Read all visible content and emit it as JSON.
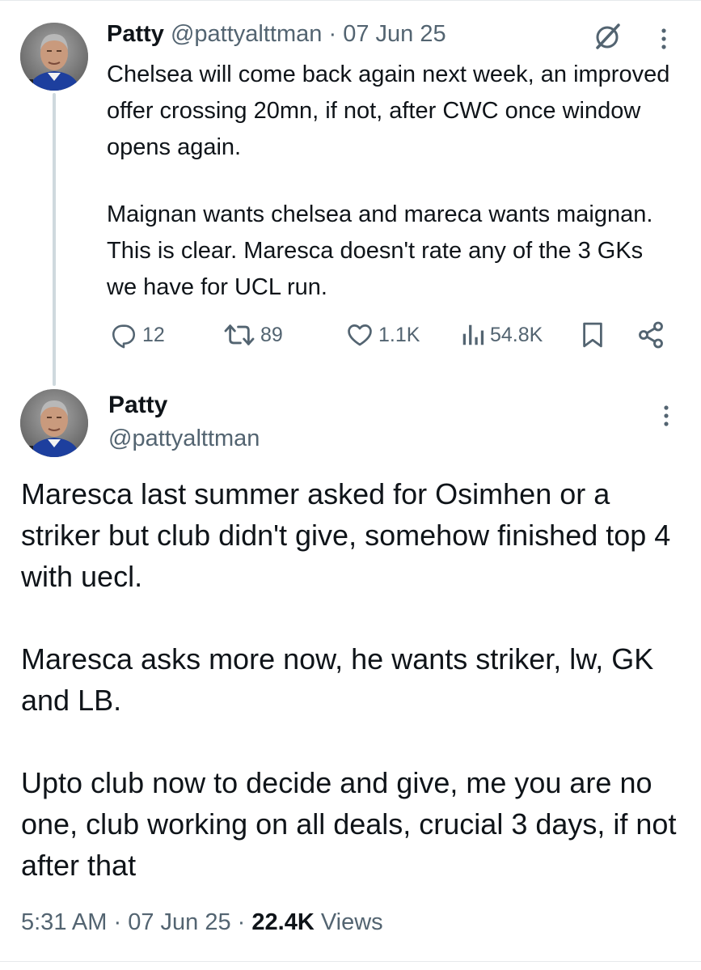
{
  "tweet1": {
    "name": "Patty",
    "handle": "@pattyalttman",
    "separator": "·",
    "date": "07 Jun 25",
    "paragraphs": [
      "Chelsea will come back again next week, an improved offer crossing 20mn, if not, after CWC once window opens again.",
      "Maignan wants chelsea and mareca wants maignan. This is clear. Maresca doesn't rate any of the 3 GKs we have for UCL run."
    ],
    "actions": {
      "replies": "12",
      "reposts": "89",
      "likes": "1.1K",
      "views": "54.8K"
    }
  },
  "tweet2": {
    "name": "Patty",
    "handle": "@pattyalttman",
    "paragraphs": [
      "Maresca last summer asked for Osimhen or a striker but club didn't give, somehow finished top 4 with uecl.",
      "Maresca asks more now, he wants striker, lw, GK and LB.",
      "Upto club now to decide and give, me you are no one, club working on all deals, crucial 3 days, if not after that"
    ],
    "time": "5:31 AM",
    "separator": "·",
    "date": "07 Jun 25",
    "views_count": "22.4K",
    "views_label": "Views"
  },
  "icons": {
    "grok": "grok-icon",
    "more": "more-vertical-icon",
    "reply": "reply-icon",
    "repost": "repost-icon",
    "like": "like-icon",
    "views": "views-icon",
    "bookmark": "bookmark-icon",
    "share": "share-icon"
  },
  "colors": {
    "text_primary": "#0f1419",
    "text_secondary": "#536471",
    "thread_line": "#cfd9de"
  }
}
